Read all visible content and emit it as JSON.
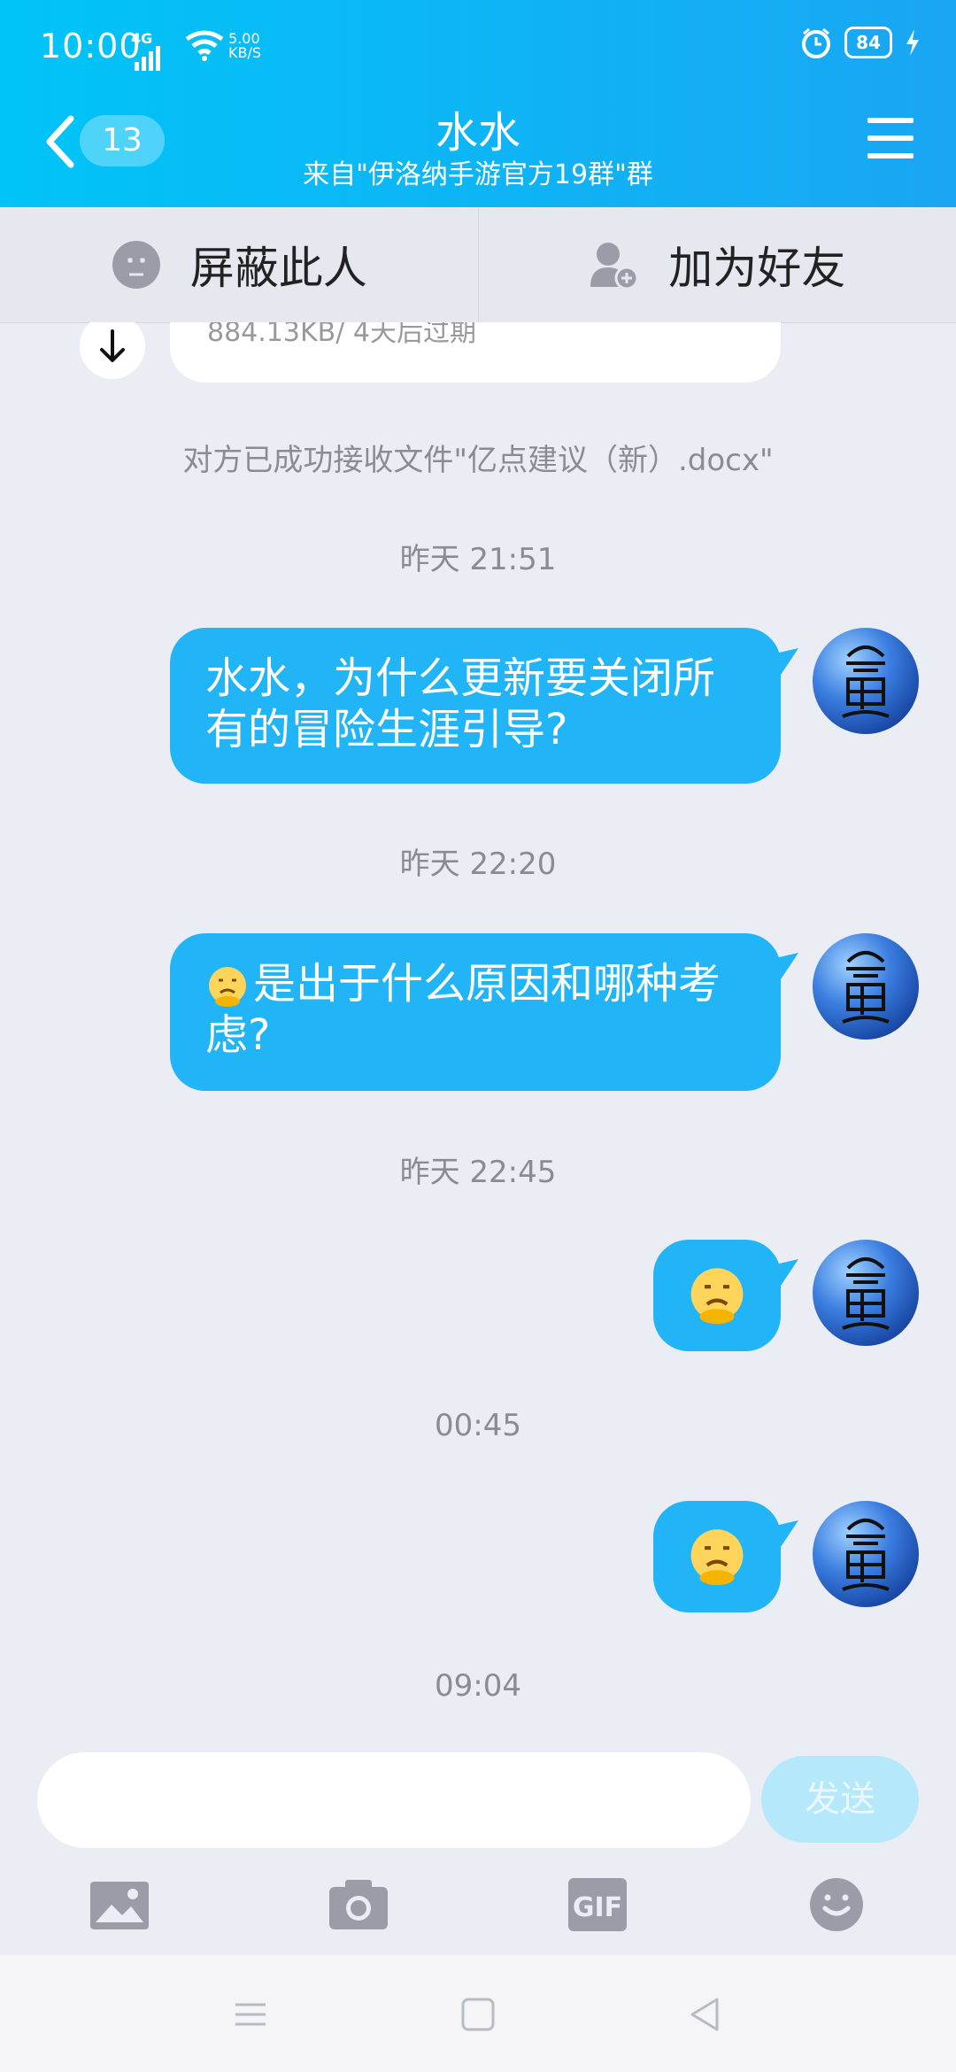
{
  "status_bar": {
    "time": "10:00",
    "network": "4G",
    "speed_value": "5.00",
    "speed_unit": "KB/S",
    "battery": "84"
  },
  "header": {
    "back_count": "13",
    "title": "水水",
    "subtitle": "来自\"伊洛纳手游官方19群\"群"
  },
  "actions": {
    "block": "屏蔽此人",
    "add_friend": "加为好友"
  },
  "chat": {
    "file_info": "884.13KB/ 4天后过期",
    "system_note": "对方已成功接收文件\"亿点建议（新）.docx\"",
    "messages": [
      {
        "time": "昨天 21:51",
        "text": "水水，为什么更新要关闭所有的冒险生涯引导?"
      },
      {
        "time": "昨天 22:20",
        "text": "是出于什么原因和哪种考虑?"
      },
      {
        "time": "昨天 22:45",
        "text": ""
      },
      {
        "time": "00:45",
        "text": ""
      },
      {
        "time": "09:04",
        "text": ""
      }
    ]
  },
  "input": {
    "placeholder": "",
    "send_label": "发送"
  },
  "colors": {
    "header_start": "#00c4f7",
    "header_end": "#1aa6f3",
    "bubble": "#21b4f7",
    "send_disabled": "#b6e8fb"
  },
  "icons": [
    "back-icon",
    "menu-icon",
    "block-icon",
    "add-friend-icon",
    "download-icon",
    "image-icon",
    "camera-icon",
    "gif-icon",
    "emoji-icon",
    "nav-menu-icon",
    "nav-home-icon",
    "nav-back-icon"
  ]
}
